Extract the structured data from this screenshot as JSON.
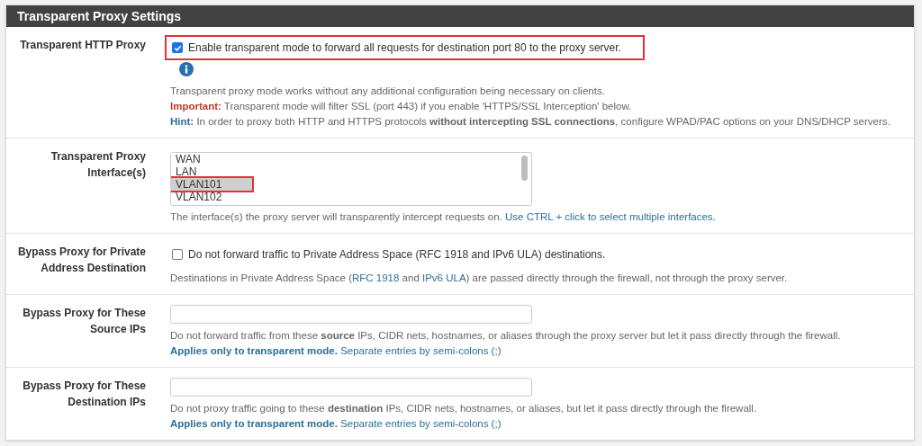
{
  "panel": {
    "title": "Transparent Proxy Settings"
  },
  "rows": [
    {
      "kind": "checkbox",
      "label": "Transparent HTTP Proxy",
      "checked": true,
      "highlighted": true,
      "option": "Enable transparent mode to forward all requests for destination port 80 to the proxy server.",
      "info_icon": true,
      "help": [
        [
          {
            "kind": "plain",
            "text": "Transparent proxy mode works without any additional configuration being necessary on clients."
          }
        ],
        [
          {
            "kind": "important",
            "text": "Important:"
          },
          {
            "kind": "plain",
            "text": " Transparent mode will filter SSL (port 443) if you enable 'HTTPS/SSL Interception' below."
          }
        ],
        [
          {
            "kind": "hint",
            "text": "Hint:"
          },
          {
            "kind": "plain",
            "text": " In order to proxy both HTTP and HTTPS protocols **without intercepting SSL connections**, configure WPAD/PAC options on your DNS/DHCP servers."
          }
        ]
      ]
    },
    {
      "kind": "listbox",
      "label": "Transparent Proxy Interface(s)",
      "options": [
        {
          "text": "WAN",
          "selected": false,
          "highlighted": false
        },
        {
          "text": "LAN",
          "selected": false,
          "highlighted": false
        },
        {
          "text": "VLAN101",
          "selected": true,
          "highlighted": true
        },
        {
          "text": "VLAN102",
          "selected": false,
          "highlighted": false
        }
      ],
      "help": [
        [
          {
            "kind": "plain",
            "text": "The interface(s) the proxy server will transparently intercept requests on. "
          },
          {
            "kind": "link",
            "text": "Use CTRL + click to select multiple interfaces."
          }
        ]
      ]
    },
    {
      "kind": "checkbox",
      "label": "Bypass Proxy for Private Address Destination",
      "checked": false,
      "highlighted": false,
      "option": "Do not forward traffic to Private Address Space (RFC 1918 and IPv6 ULA) destinations.",
      "info_icon": false,
      "help": [
        [
          {
            "kind": "plain",
            "text": "Destinations in Private Address Space ("
          },
          {
            "kind": "link",
            "text": "RFC 1918"
          },
          {
            "kind": "plain",
            "text": " and "
          },
          {
            "kind": "link",
            "text": "IPv6 ULA"
          },
          {
            "kind": "plain",
            "text": ") are passed directly through the firewall, not through the proxy server."
          }
        ]
      ]
    },
    {
      "kind": "text",
      "label": "Bypass Proxy for These Source IPs",
      "help": [
        [
          {
            "kind": "plain",
            "text": "Do not forward traffic from these **source** IPs, CIDR nets, hostnames, or aliases through the proxy server but let it pass directly through the firewall."
          }
        ],
        [
          {
            "kind": "hint",
            "text": "Applies only to transparent mode."
          },
          {
            "kind": "link",
            "text": " Separate entries by semi-colons (;)"
          }
        ]
      ]
    },
    {
      "kind": "text",
      "label": "Bypass Proxy for These Destination IPs",
      "help": [
        [
          {
            "kind": "plain",
            "text": "Do not proxy traffic going to these **destination** IPs, CIDR nets, hostnames, or aliases, but let it pass directly through the firewall."
          }
        ],
        [
          {
            "kind": "hint",
            "text": "Applies only to transparent mode."
          },
          {
            "kind": "link",
            "text": " Separate entries by semi-colons (;)"
          }
        ]
      ]
    }
  ]
}
